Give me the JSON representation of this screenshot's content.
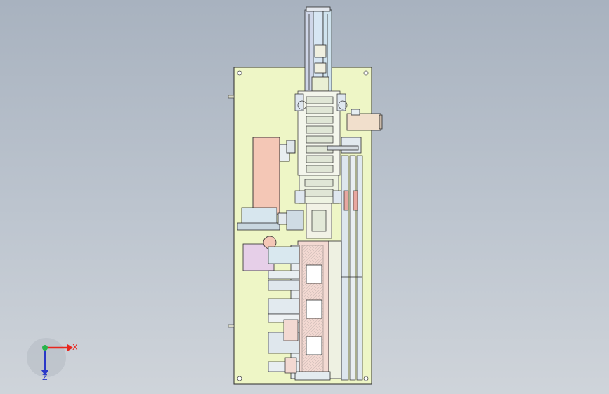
{
  "colors": {
    "background_top": "#a8b2bf",
    "background_bottom": "#cfd4da",
    "baseplate": "#eef6c6",
    "outline": "#2b2b2b",
    "salmon_block": "#f4c7b6",
    "lavender_block": "#e6cfe8",
    "light_blue": "#cfe3ee",
    "pink_rail": "#f3d9d2",
    "x_axis": "#e8261e",
    "y_axis": "#27b44a",
    "z_axis": "#2a38c8"
  },
  "triad": {
    "x_label": "X",
    "z_label": "Z",
    "x_icon": "x-axis-arrow-icon",
    "y_icon": "y-axis-dot-icon",
    "z_icon": "z-axis-arrow-icon"
  }
}
